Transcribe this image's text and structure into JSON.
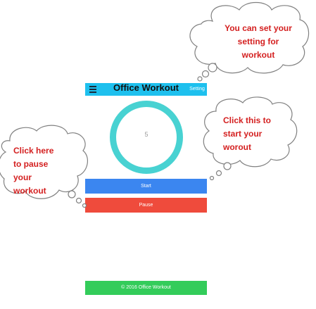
{
  "app": {
    "title": "Office Workout",
    "setting_label": "Setting",
    "timer_value": "5",
    "start_label": "Start",
    "pause_label": "Pause",
    "footer_text": "© 2016 Office Workout"
  },
  "colors": {
    "header": "#1ec0ee",
    "ring": "#48d2d2",
    "start": "#3b86f0",
    "pause": "#ef4b3c",
    "footer": "#33cc5a",
    "callout_text": "#d42020"
  },
  "callouts": {
    "setting": {
      "lines": [
        "You can set your",
        "setting for",
        "workout"
      ]
    },
    "start": {
      "lines": [
        "Click this to",
        "start your",
        "worout"
      ]
    },
    "pause": {
      "lines": [
        "Click here",
        "to pause",
        "your",
        "workout"
      ]
    }
  }
}
